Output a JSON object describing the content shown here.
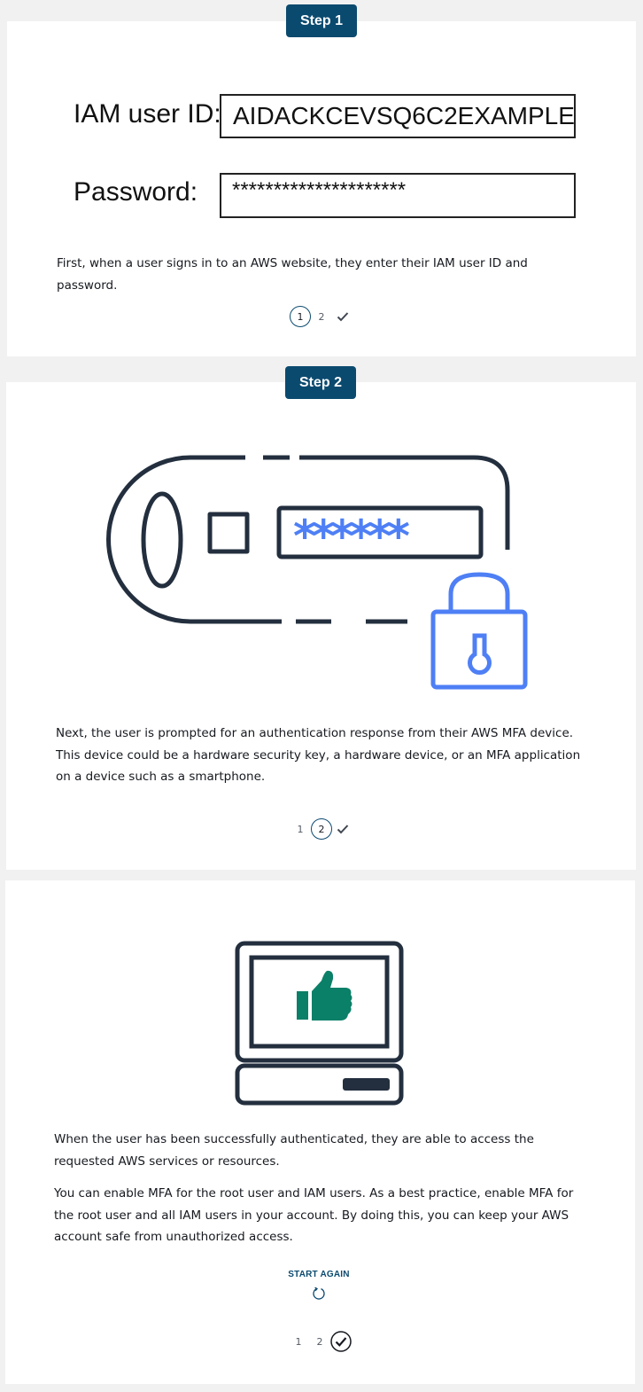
{
  "step1": {
    "badge": "Step 1",
    "userid_label": "IAM user ID:",
    "userid_value": "AIDACKCEVSQ6C2EXAMPLE",
    "password_label": "Password:",
    "password_value": "*********************",
    "description": "First, when a user signs in to an AWS website, they enter their IAM user ID and password.",
    "pager": {
      "num1": "1",
      "num2": "2",
      "active": 1
    }
  },
  "step2": {
    "badge": "Step 2",
    "description": "Next, the user is prompted for an authentication response from their AWS MFA device. This device could be a hardware security key, a hardware device, or an MFA application on a device such as a smartphone.",
    "pager": {
      "num1": "1",
      "num2": "2",
      "active": 2
    }
  },
  "step3": {
    "description_1": "When the user has been successfully authenticated, they are able to access the requested AWS services or resources.",
    "description_2": "You can enable MFA for the root user and IAM users. As a best practice, enable MFA for the root user and all IAM users in your account. By doing this, you can keep your AWS account safe from unauthorized access.",
    "start_again": "START AGAIN",
    "pager": {
      "num1": "1",
      "num2": "2",
      "active": "check"
    }
  },
  "icons": {
    "complete": "checkmark-icon",
    "restart": "restart-icon",
    "security_key": "security-key-icon",
    "lock": "padlock-icon",
    "computer": "computer-icon",
    "thumbs_up": "thumbs-up-icon"
  },
  "colors": {
    "badge": "#0b4a6f",
    "accent_blue": "#4e7ff5",
    "thumbs_green": "#0b8068",
    "outline_dark": "#232f3e"
  }
}
